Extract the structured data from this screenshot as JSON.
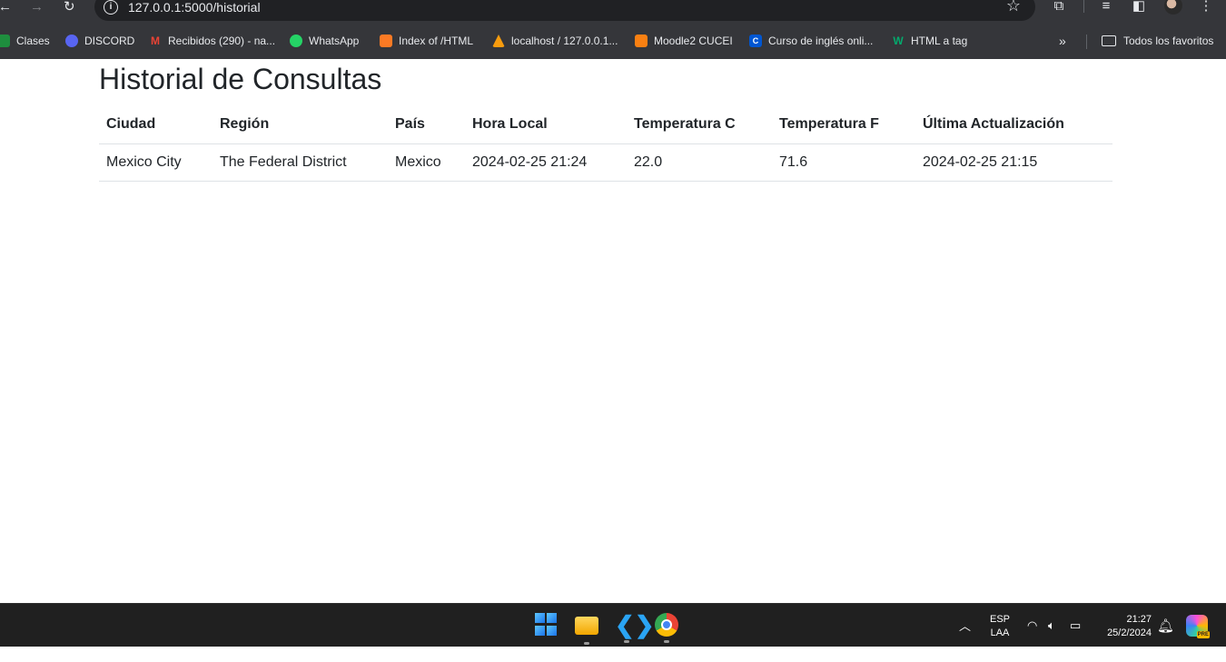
{
  "browser": {
    "url": "127.0.0.1:5000/historial",
    "bookmarks": [
      {
        "label": "Clases",
        "icon": "classroom-icon",
        "color": "#1e8e3e"
      },
      {
        "label": "DISCORD",
        "icon": "discord-icon",
        "color": "#5865f2"
      },
      {
        "label": "Recibidos (290) - na...",
        "icon": "gmail-icon",
        "color": "#ea4335"
      },
      {
        "label": "WhatsApp",
        "icon": "whatsapp-icon",
        "color": "#25d366"
      },
      {
        "label": "Index of /HTML",
        "icon": "xampp-icon",
        "color": "#fb7a24"
      },
      {
        "label": "localhost / 127.0.0.1...",
        "icon": "phpmyadmin-icon",
        "color": "#f89c0e"
      },
      {
        "label": "Moodle2 CUCEI",
        "icon": "moodle-icon",
        "color": "#f98012"
      },
      {
        "label": "Curso de inglés onli...",
        "icon": "course-icon",
        "color": "#0056d2"
      },
      {
        "label": "HTML a tag",
        "icon": "w3schools-icon",
        "color": "#04aa6d"
      }
    ],
    "all_bookmarks_label": "Todos los favoritos"
  },
  "page": {
    "title": "Historial de Consultas",
    "table": {
      "headers": [
        "Ciudad",
        "Región",
        "País",
        "Hora Local",
        "Temperatura C",
        "Temperatura F",
        "Última Actualización"
      ],
      "rows": [
        [
          "Mexico City",
          "The Federal District",
          "Mexico",
          "2024-02-25 21:24",
          "22.0",
          "71.6",
          "2024-02-25 21:15"
        ]
      ]
    }
  },
  "taskbar": {
    "language": "ESP",
    "layout": "LAA",
    "time": "21:27",
    "date": "25/2/2024",
    "copilot_badge": "PRE"
  }
}
